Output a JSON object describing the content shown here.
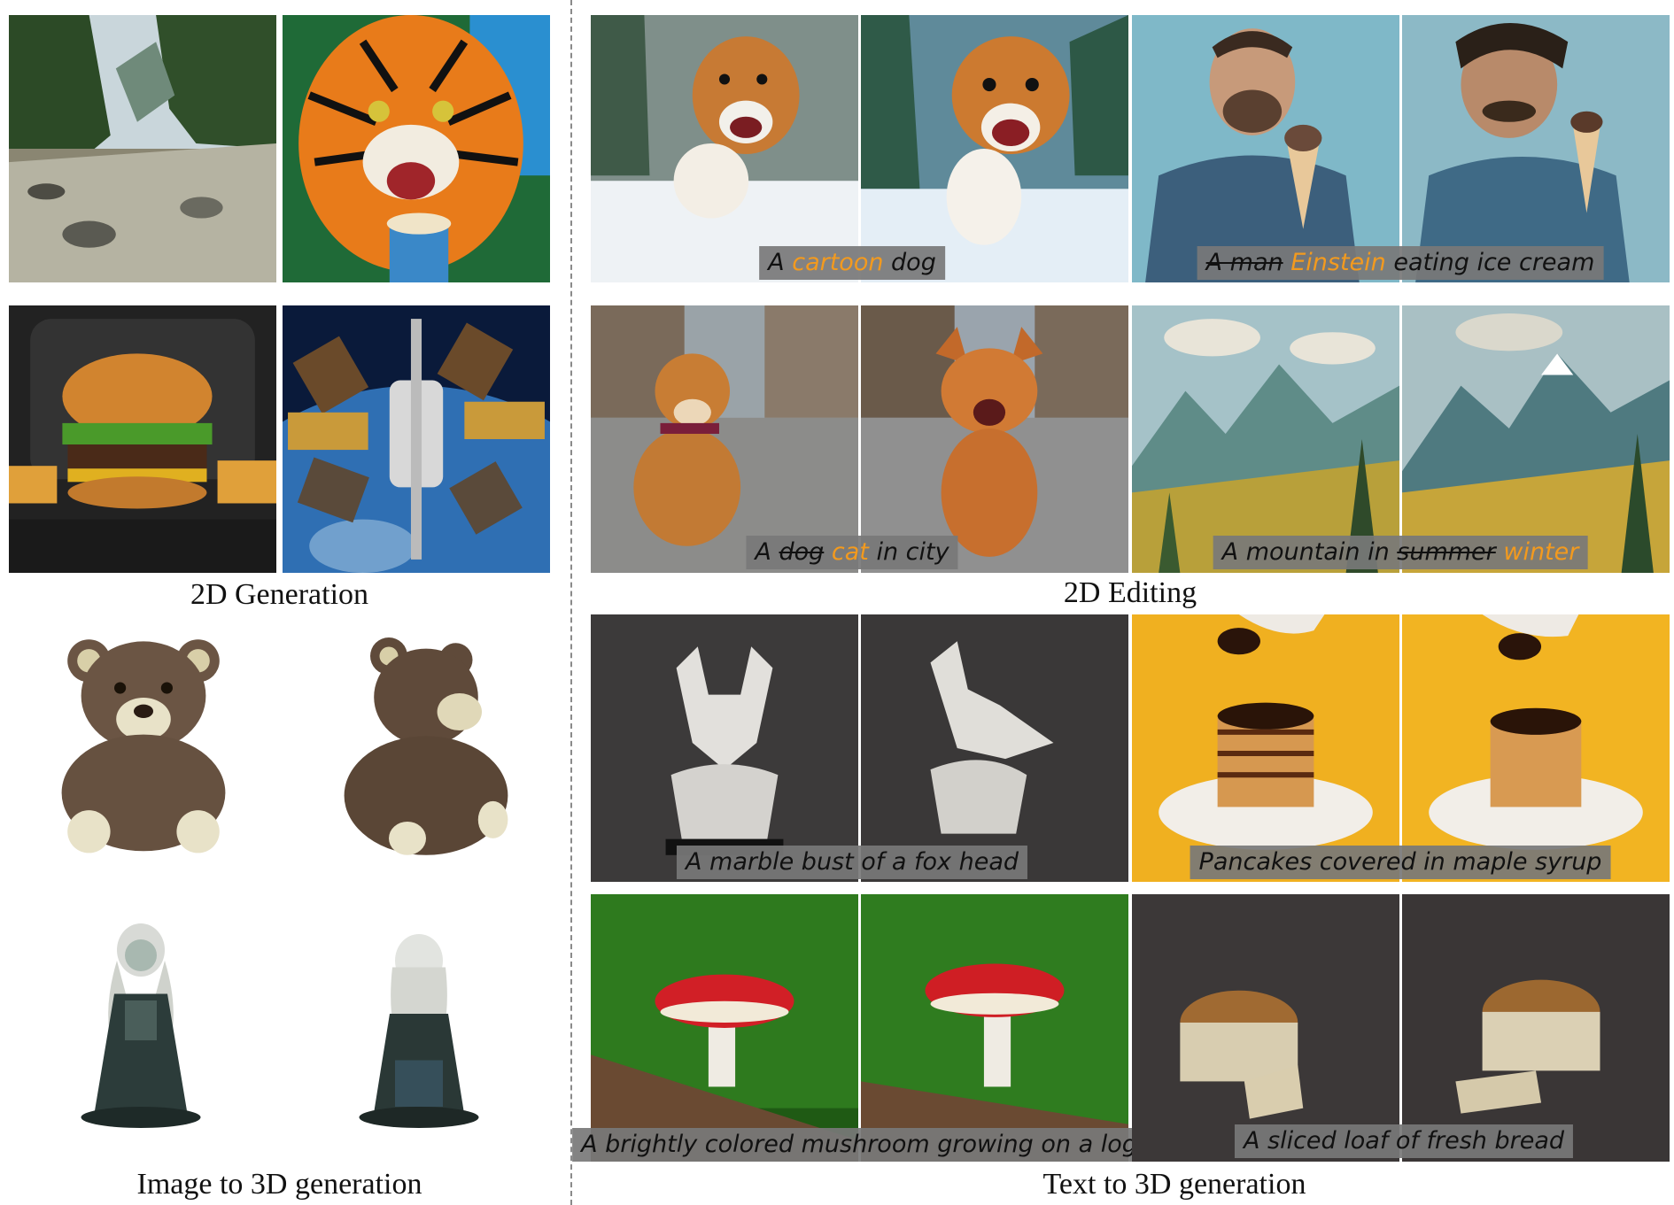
{
  "sections": {
    "gen2d": "2D Generation",
    "img3d": "Image to 3D generation",
    "edit2d": "2D Editing",
    "txt3d": "Text to 3D generation"
  },
  "prompts": {
    "dog": {
      "p1": "A ",
      "hl": "cartoon",
      "p2": " dog"
    },
    "man": {
      "del": "A man",
      "hl": "Einstein",
      "p2": " eating ice cream"
    },
    "cat": {
      "p1": "A ",
      "del": "dog",
      "hl": "cat",
      "p2": " in city"
    },
    "mountain": {
      "p1": "A mountain in ",
      "del": "summer",
      "hl": "winter"
    },
    "fox": "A marble bust of a fox head",
    "pancakes": "Pancakes covered in maple syrup",
    "mushroom": "A brightly colored mushroom growing on a log",
    "bread": "A sliced loaf of fresh bread"
  },
  "colors": {
    "highlight": "#f39a1e",
    "prompt_bg": "#787878",
    "divider": "#8a8a8a"
  }
}
